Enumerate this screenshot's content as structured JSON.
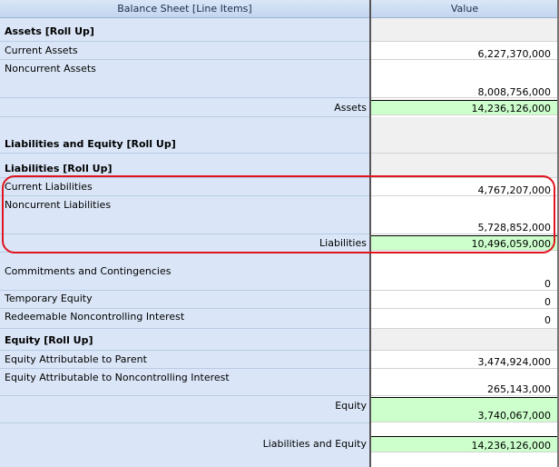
{
  "header": {
    "label_col": "Balance Sheet [Line Items]",
    "value_col": "Value"
  },
  "assets": {
    "section": "Assets [Roll Up]",
    "current_label": "Current Assets",
    "current_value": "6,227,370,000",
    "noncurrent_label": "Noncurrent Assets",
    "noncurrent_value": "8,008,756,000",
    "total_label": "Assets",
    "total_value": "14,236,126,000"
  },
  "le": {
    "section": "Liabilities and Equity [Roll Up]"
  },
  "liabilities": {
    "section": "Liabilities [Roll Up]",
    "current_label": "Current Liabilities",
    "current_value": "4,767,207,000",
    "noncurrent_label": "Noncurrent Liabilities",
    "noncurrent_value": "5,728,852,000",
    "total_label": "Liabilities",
    "total_value": "10,496,059,000"
  },
  "other": {
    "commitments_label": "Commitments and Contingencies",
    "commitments_value": "0",
    "temporary_label": "Temporary Equity",
    "temporary_value": "0",
    "redeemable_label": "Redeemable Noncontrolling Interest",
    "redeemable_value": "0"
  },
  "equity": {
    "section": "Equity [Roll Up]",
    "parent_label": "Equity Attributable to Parent",
    "parent_value": "3,474,924,000",
    "nci_label": "Equity Attributable to Noncontrolling Interest",
    "nci_value": "265,143,000",
    "total_label": "Equity",
    "total_value": "3,740,067,000"
  },
  "grand_total": {
    "label": "Liabilities and Equity",
    "value": "14,236,126,000"
  }
}
